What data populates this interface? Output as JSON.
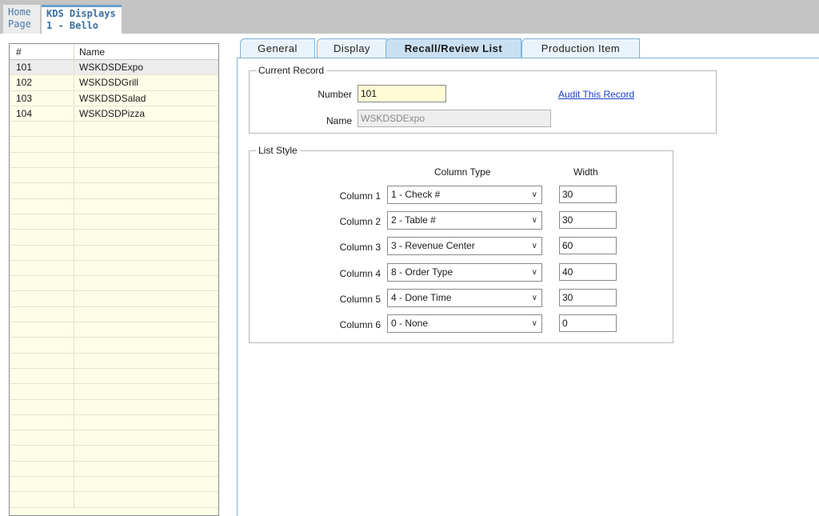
{
  "top_tabs": {
    "home": {
      "line1": "Home",
      "line2": "Page"
    },
    "active": {
      "line1": "KDS Displays",
      "line2": "1 - Bello"
    }
  },
  "grid": {
    "headers": {
      "num": "#",
      "name": "Name"
    },
    "rows": [
      {
        "num": "101",
        "name": "WSKDSDExpo"
      },
      {
        "num": "102",
        "name": "WSKDSDGrill"
      },
      {
        "num": "103",
        "name": "WSKDSDSalad"
      },
      {
        "num": "104",
        "name": "WSKDSDPizza"
      }
    ]
  },
  "tabs": [
    "General",
    "Display",
    "Recall/Review List",
    "Production Item"
  ],
  "current_record": {
    "title": "Current Record",
    "number_label": "Number",
    "number_value": "101",
    "name_label": "Name",
    "name_value": "WSKDSDExpo",
    "audit_link": "Audit This Record"
  },
  "list_style": {
    "title": "List Style",
    "column_type_header": "Column Type",
    "width_header": "Width",
    "columns": [
      {
        "label": "Column 1",
        "type": "1 - Check #",
        "width": "30"
      },
      {
        "label": "Column 2",
        "type": "2 - Table #",
        "width": "30"
      },
      {
        "label": "Column 3",
        "type": "3 - Revenue Center",
        "width": "60"
      },
      {
        "label": "Column 4",
        "type": "8 - Order Type",
        "width": "40"
      },
      {
        "label": "Column 5",
        "type": "4 - Done Time",
        "width": "30"
      },
      {
        "label": "Column 6",
        "type": "0 - None",
        "width": "0"
      }
    ]
  },
  "icons": {
    "dropdown": "chevron-down-icon"
  }
}
